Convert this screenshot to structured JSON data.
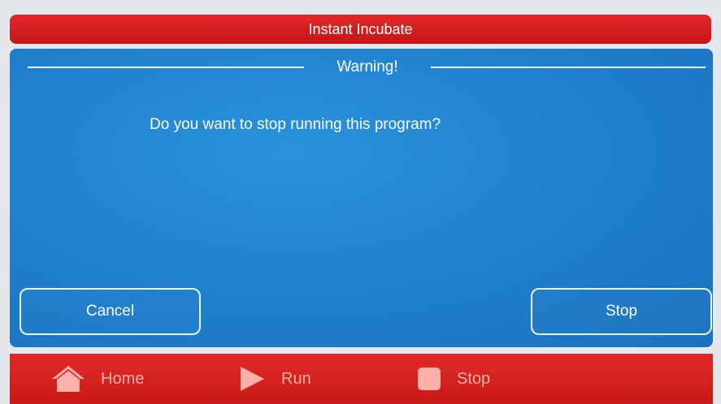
{
  "header": {
    "title": "Instant Incubate"
  },
  "dialog": {
    "heading": "Warning!",
    "message": "Do you want to stop running this program?",
    "cancel_label": "Cancel",
    "stop_label": "Stop"
  },
  "bottom_nav": {
    "items": [
      {
        "label": "Home",
        "icon": "home-icon"
      },
      {
        "label": "Run",
        "icon": "play-icon"
      },
      {
        "label": "Stop",
        "icon": "stop-icon"
      }
    ]
  },
  "colors": {
    "header_red": "#d41f1f",
    "panel_blue": "#1f7fcd",
    "nav_text": "#ffb0a8"
  }
}
